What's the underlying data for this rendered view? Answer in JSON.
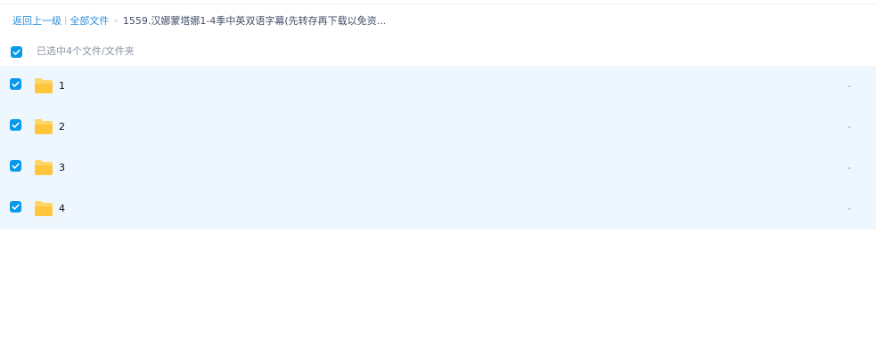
{
  "breadcrumb": {
    "back_label": "返回上一级",
    "separator": "|",
    "all_files_label": "全部文件",
    "arrow": "»",
    "current_folder": "1559.汉娜蒙塔娜1-4季中英双语字幕(先转存再下载以免资..."
  },
  "selection": {
    "checked": true,
    "summary": "已选中4个文件/文件夹"
  },
  "files": [
    {
      "name": "1",
      "size": "-",
      "checked": true,
      "icon": "folder-icon"
    },
    {
      "name": "2",
      "size": "-",
      "checked": true,
      "icon": "folder-icon"
    },
    {
      "name": "3",
      "size": "-",
      "checked": true,
      "icon": "folder-icon"
    },
    {
      "name": "4",
      "size": "-",
      "checked": true,
      "icon": "folder-icon"
    }
  ],
  "colors": {
    "accent": "#0698ec",
    "link": "#2f8fd8",
    "selected_row_bg": "#eff7fe",
    "folder_body": "#ffc53d",
    "folder_tab": "#ffd666"
  }
}
